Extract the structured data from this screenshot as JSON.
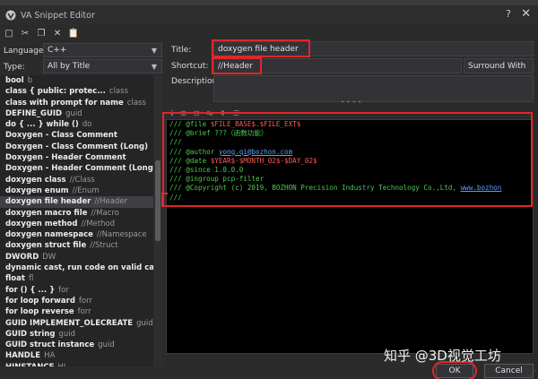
{
  "window": {
    "title": "VA Snippet Editor",
    "help_glyph": "?",
    "close_glyph": "✕"
  },
  "toolbar": [
    {
      "name": "new-snippet-icon",
      "glyph": "□"
    },
    {
      "name": "cut-icon",
      "glyph": "✂"
    },
    {
      "name": "copy-icon",
      "glyph": "❐"
    },
    {
      "name": "delete-icon",
      "glyph": "✕"
    },
    {
      "name": "paste-icon",
      "glyph": "📋"
    }
  ],
  "form": {
    "language_label": "Language:",
    "language_value": "C++",
    "type_label": "Type:",
    "type_value": "All by Title",
    "title_label": "Title:",
    "title_value": "doxygen file header",
    "shortcut_label": "Shortcut:",
    "shortcut_value": "//Header",
    "surround_label": "Surround With",
    "description_label": "Description:",
    "description_value": ""
  },
  "snippets": [
    {
      "title": "bool",
      "hint": "b"
    },
    {
      "title": "class  { public: protec...",
      "hint": "class"
    },
    {
      "title": "class with prompt for name",
      "hint": "class"
    },
    {
      "title": "DEFINE_GUID",
      "hint": "guid"
    },
    {
      "title": "do { ... } while ()",
      "hint": "do"
    },
    {
      "title": "Doxygen - Class Comment",
      "hint": ""
    },
    {
      "title": "Doxygen - Class Comment (Long)",
      "hint": ""
    },
    {
      "title": "Doxygen - Header Comment",
      "hint": ""
    },
    {
      "title": "Doxygen - Header Comment (Long)",
      "hint": ""
    },
    {
      "title": "doxygen class",
      "hint": "//Class"
    },
    {
      "title": "doxygen enum",
      "hint": "//Enum"
    },
    {
      "title": "doxygen file header",
      "hint": "//Header",
      "selected": true
    },
    {
      "title": "doxygen macro file",
      "hint": "//Macro"
    },
    {
      "title": "doxygen method",
      "hint": "//Method"
    },
    {
      "title": "doxygen namespace",
      "hint": "//Namespace"
    },
    {
      "title": "doxygen struct file",
      "hint": "//Struct"
    },
    {
      "title": "DWORD",
      "hint": "DW"
    },
    {
      "title": "dynamic cast, run code on valid cast",
      "hint": "dy"
    },
    {
      "title": "float",
      "hint": "fl"
    },
    {
      "title": "for () { ... }",
      "hint": "for"
    },
    {
      "title": "for loop forward",
      "hint": "forr"
    },
    {
      "title": "for loop reverse",
      "hint": "forr"
    },
    {
      "title": "GUID IMPLEMENT_OLECREATE",
      "hint": "guid"
    },
    {
      "title": "GUID string",
      "hint": "guid"
    },
    {
      "title": "GUID struct instance",
      "hint": "guid"
    },
    {
      "title": "HANDLE",
      "hint": "HA"
    },
    {
      "title": "HINSTANCE",
      "hint": "HI"
    }
  ],
  "editor_toolbar": [
    "ℹ",
    "⊞",
    "⊟",
    "↹",
    "↕",
    "☰"
  ],
  "code_lines": [
    [
      {
        "t": "/// @file   ",
        "c": "green"
      },
      {
        "t": "$FILE_BASE$",
        "c": "red"
      },
      {
        "t": ".",
        "c": "green"
      },
      {
        "t": "$FILE_EXT$",
        "c": "red"
      }
    ],
    [
      {
        "t": "/// @brief  ???（函数功能）",
        "c": "green"
      }
    ],
    [
      {
        "t": "///",
        "c": "green"
      }
    ],
    [
      {
        "t": "/// @author ",
        "c": "green"
      },
      {
        "t": "yong.qi@bozhon.com",
        "c": "link"
      }
    ],
    [
      {
        "t": "/// @date  ",
        "c": "green"
      },
      {
        "t": "$YEAR$-$MONTH_02$-$DAY_02$",
        "c": "red"
      }
    ],
    [
      {
        "t": "/// @since 1.0.0.0",
        "c": "green"
      }
    ],
    [
      {
        "t": "/// @ingroup pcp-filter",
        "c": "green"
      }
    ],
    [
      {
        "t": "/// @Copyright (c) 2019, BOZHON Precision Industry Technology Co.,Ltd, ",
        "c": "green"
      },
      {
        "t": "www.bozhon",
        "c": "link"
      }
    ],
    [
      {
        "t": "///",
        "c": "green"
      }
    ]
  ],
  "buttons": {
    "ok": "OK",
    "cancel": "Cancel"
  },
  "watermark": "知乎 @3D视觉工坊",
  "colors": {
    "highlight": "#e0262b",
    "comment_green": "#4ec94e",
    "variable_red": "#ff5a5a",
    "link_blue": "#5aa0ff"
  }
}
